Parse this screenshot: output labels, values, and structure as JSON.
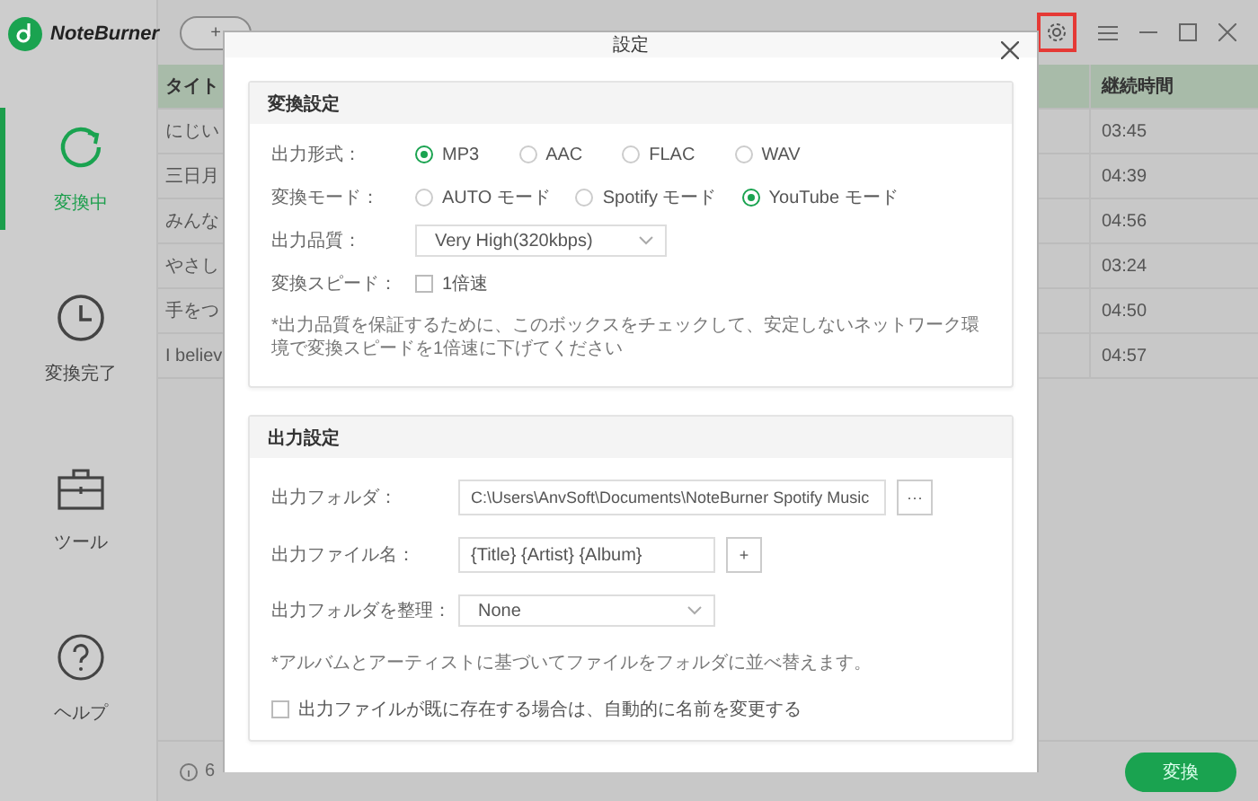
{
  "app": {
    "logo": "NoteBurner"
  },
  "sidebar": {
    "items": [
      {
        "label": "変換中",
        "selected": true
      },
      {
        "label": "変換完了",
        "selected": false
      },
      {
        "label": "ツール",
        "selected": false
      },
      {
        "label": "ヘルプ",
        "selected": false
      }
    ]
  },
  "toolbar": {
    "add_button": "+"
  },
  "table": {
    "columns": [
      "タイト",
      "継続時間"
    ],
    "rows": [
      {
        "title": "にじい",
        "duration": "03:45"
      },
      {
        "title": "三日月",
        "duration": "04:39"
      },
      {
        "title": "みんな",
        "duration": "04:56"
      },
      {
        "title": "やさし",
        "duration": "03:24"
      },
      {
        "title": "手をつ",
        "duration": "04:50"
      },
      {
        "title": "I believ",
        "duration": "04:57"
      }
    ]
  },
  "status_bar": {
    "count": "6",
    "convert_button": "変換"
  },
  "dialog": {
    "title": "設定",
    "conversion": {
      "heading": "変換設定",
      "format": {
        "label": "出力形式：",
        "options": [
          {
            "label": "MP3",
            "selected": true
          },
          {
            "label": "AAC",
            "selected": false
          },
          {
            "label": "FLAC",
            "selected": false
          },
          {
            "label": "WAV",
            "selected": false
          }
        ]
      },
      "mode": {
        "label": "変換モード：",
        "options": [
          {
            "label": "AUTO モード",
            "selected": false
          },
          {
            "label": "Spotify モード",
            "selected": false
          },
          {
            "label": "YouTube モード",
            "selected": true
          }
        ]
      },
      "quality": {
        "label": "出力品質：",
        "value": "Very High(320kbps)"
      },
      "speed": {
        "label": "変換スピード：",
        "option": "1倍速",
        "checked": false
      },
      "note": "*出力品質を保証するために、このボックスをチェックして、安定しないネットワーク環境で変換スピードを1倍速に下げてください"
    },
    "output": {
      "heading": "出力設定",
      "folder": {
        "label": "出力フォルダ：",
        "value": "C:\\Users\\AnvSoft\\Documents\\NoteBurner Spotify Music",
        "button": "···"
      },
      "filename": {
        "label": "出力ファイル名：",
        "value": "{Title} {Artist} {Album}",
        "button": "+"
      },
      "organize": {
        "label": "出力フォルダを整理：",
        "value": "None"
      },
      "note": "*アルバムとアーティストに基づいてファイルをフォルダに並べ替えます。",
      "rename": {
        "label": "出力ファイルが既に存在する場合は、自動的に名前を変更する",
        "checked": false
      }
    }
  }
}
